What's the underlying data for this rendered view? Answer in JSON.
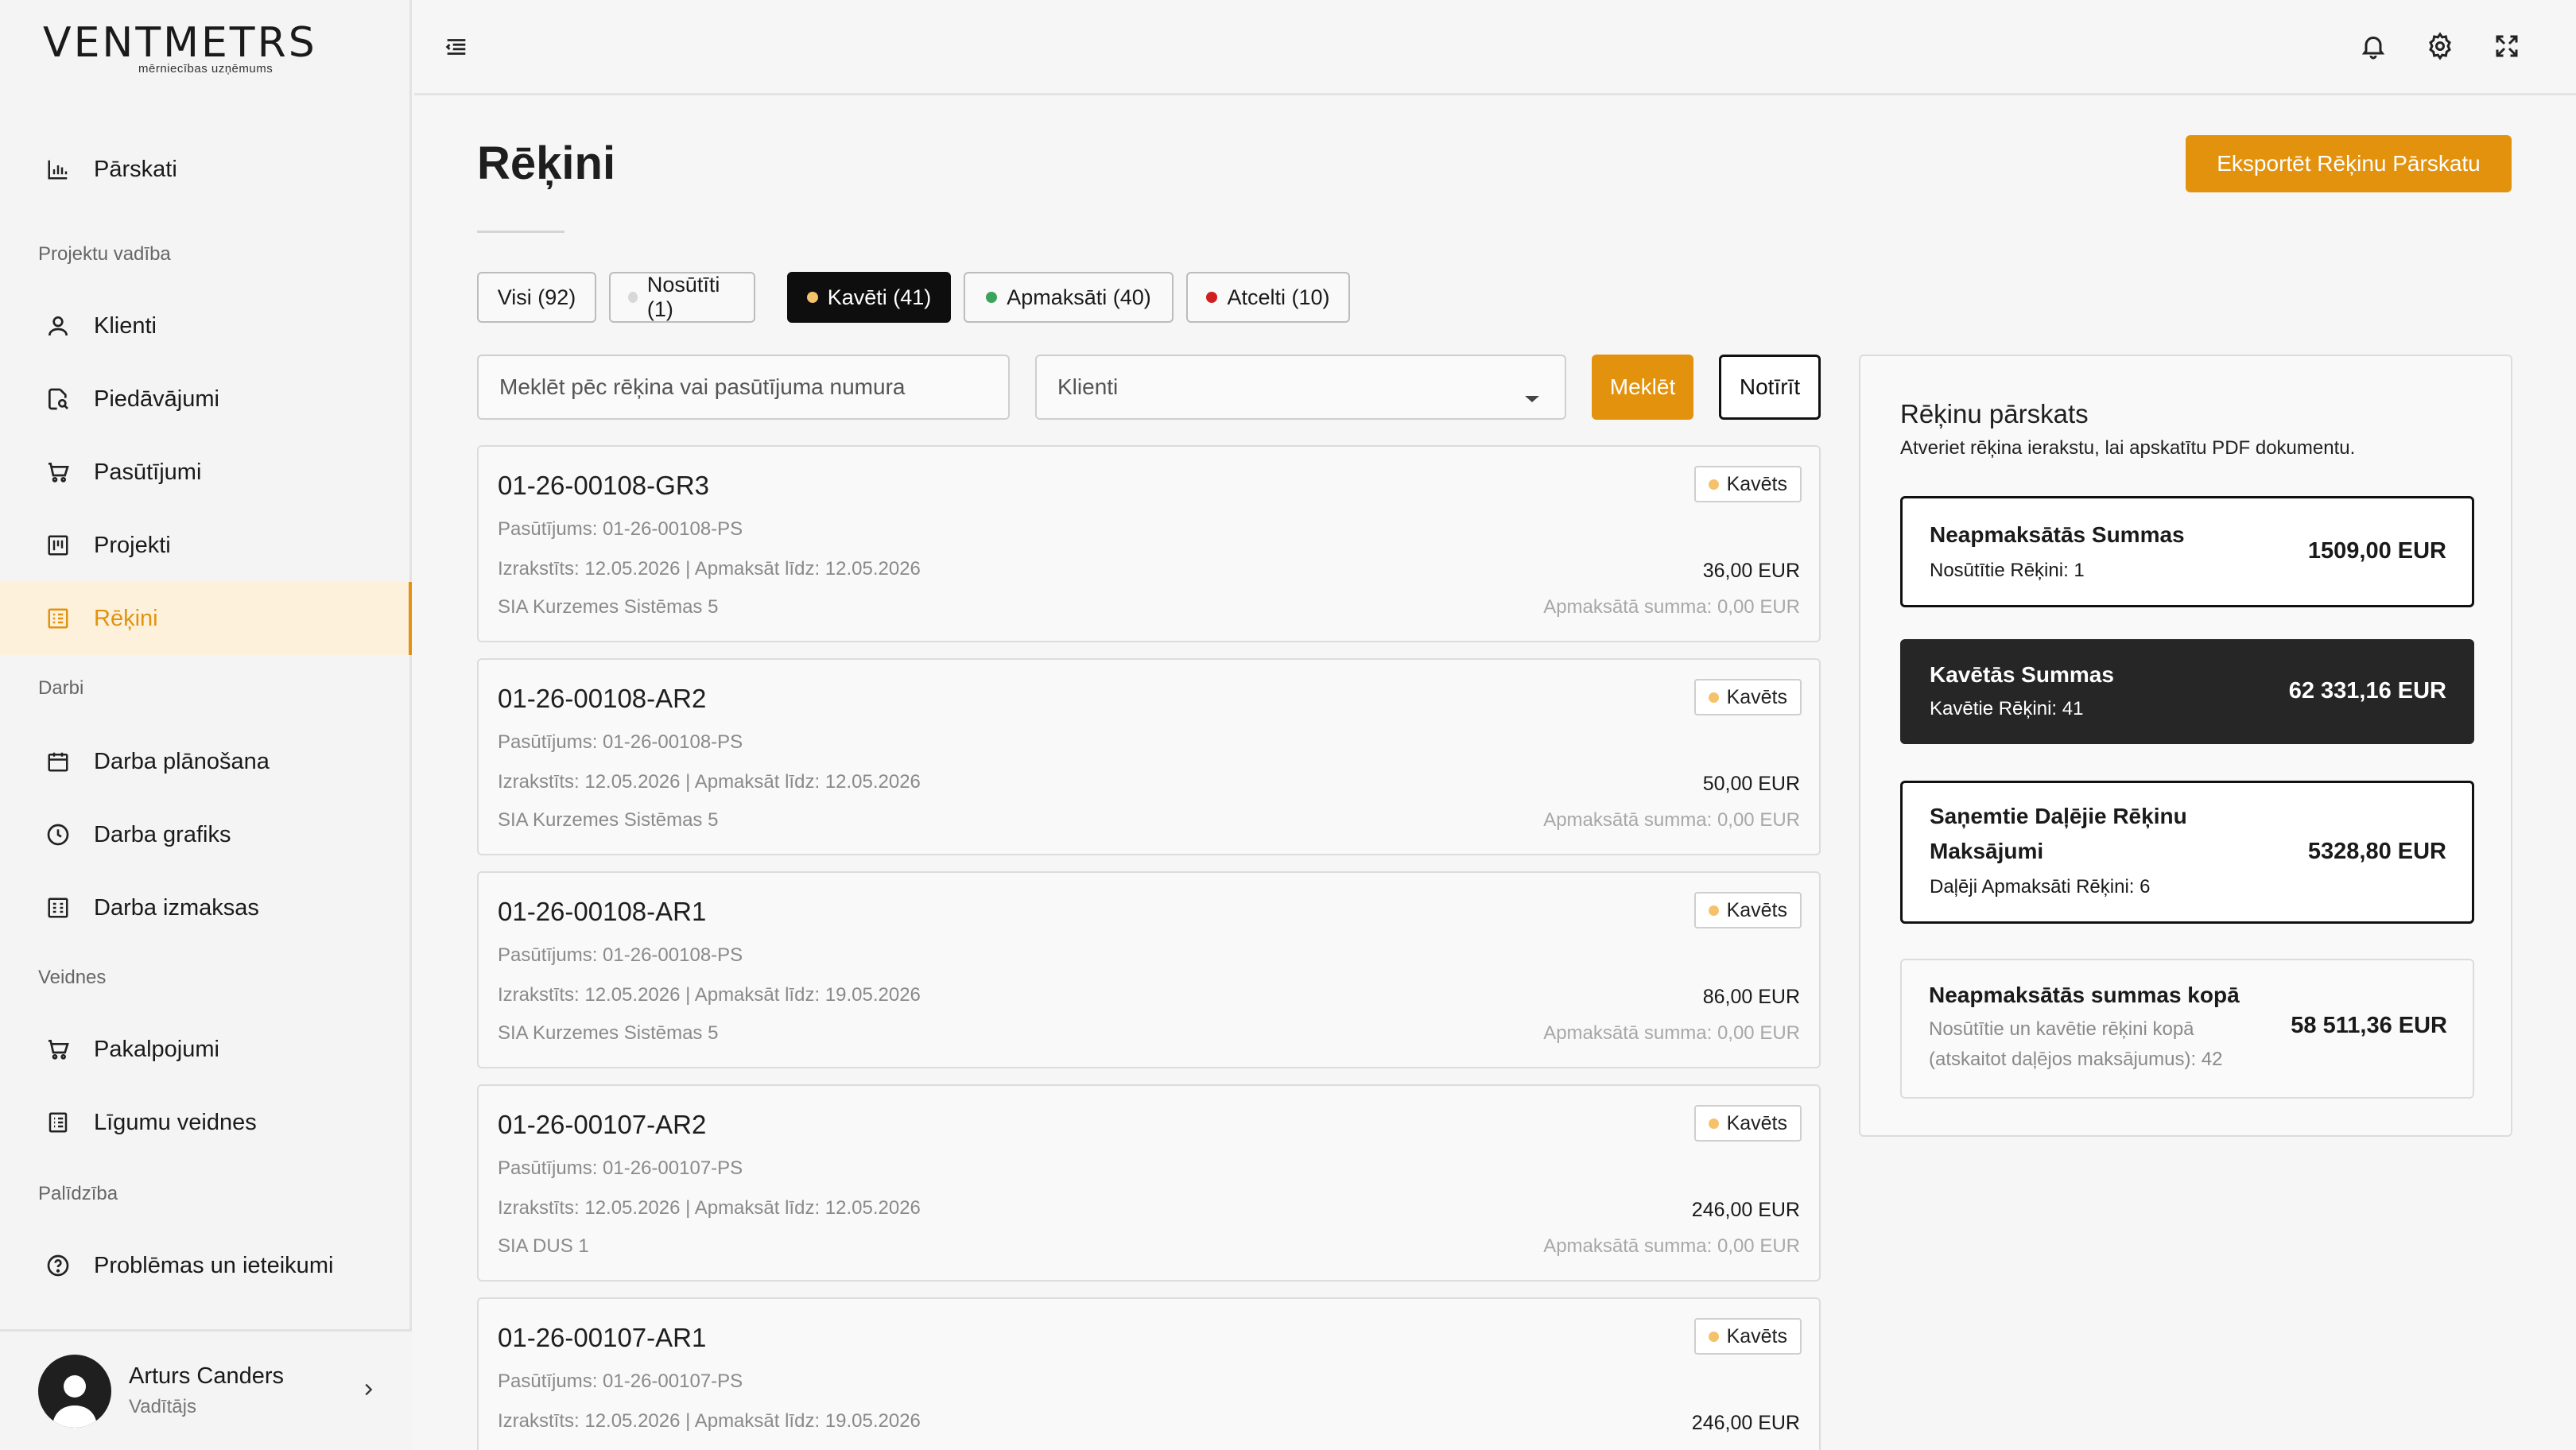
{
  "brand": {
    "name": "VENTMETRS",
    "tagline": "mērniecības uzņēmums"
  },
  "sidebar": {
    "items": [
      {
        "label": "Pārskati",
        "icon": "bar-chart-icon"
      },
      {
        "section": "Projektu vadība"
      },
      {
        "label": "Klienti",
        "icon": "user-icon"
      },
      {
        "label": "Piedāvājumi",
        "icon": "document-search-icon"
      },
      {
        "label": "Pasūtījumi",
        "icon": "cart-icon"
      },
      {
        "label": "Projekti",
        "icon": "kanban-icon"
      },
      {
        "label": "Rēķini",
        "icon": "invoice-icon",
        "active": true
      },
      {
        "section": "Darbi"
      },
      {
        "label": "Darba plānošana",
        "icon": "calendar-icon"
      },
      {
        "label": "Darba grafiks",
        "icon": "clock-icon"
      },
      {
        "label": "Darba izmaksas",
        "icon": "calculator-icon"
      },
      {
        "section": "Veidnes"
      },
      {
        "label": "Pakalpojumi",
        "icon": "cart-icon"
      },
      {
        "label": "Līgumu veidnes",
        "icon": "list-document-icon"
      },
      {
        "section": "Palīdzība"
      },
      {
        "label": "Problēmas un ieteikumi",
        "icon": "help-circle-icon"
      }
    ],
    "labels": {
      "reports": "Pārskati",
      "section_projects": "Projektu vadība",
      "clients": "Klienti",
      "offers": "Piedāvājumi",
      "orders": "Pasūtījumi",
      "projects": "Projekti",
      "invoices": "Rēķini",
      "section_work": "Darbi",
      "work_planning": "Darba plānošana",
      "work_schedule": "Darba grafiks",
      "work_costs": "Darba izmaksas",
      "section_templates": "Veidnes",
      "services": "Pakalpojumi",
      "contract_templates": "Līgumu veidnes",
      "section_help": "Palīdzība",
      "issues": "Problēmas un ieteikumi"
    }
  },
  "user": {
    "name": "Arturs Canders",
    "role": "Vadītājs"
  },
  "page": {
    "title": "Rēķini",
    "export_label": "Eksportēt Rēķinu Pārskatu"
  },
  "tabs": [
    {
      "label": "Visi (92)",
      "dot": null,
      "active": false
    },
    {
      "label": "Nosūtīti (1)",
      "dot": "#d8d8d8",
      "active": false
    },
    {
      "label": "Kavēti (41)",
      "dot": "#f5c26b",
      "active": true
    },
    {
      "label": "Apmaksāti (40)",
      "dot": "#3aa55a",
      "active": false
    },
    {
      "label": "Atcelti (10)",
      "dot": "#d11f1f",
      "active": false
    }
  ],
  "filters": {
    "search_placeholder": "Meklēt pēc rēķina vai pasūtījuma numura",
    "client_placeholder": "Klienti",
    "search_label": "Meklēt",
    "clear_label": "Notīrīt"
  },
  "invoices": [
    {
      "number": "01-26-00108-GR3",
      "order": "Pasūtījums: 01-26-00108-PS",
      "dates": "Izrakstīts: 12.05.2026 | Apmaksāt līdz: 12.05.2026",
      "client": "SIA Kurzemes Sistēmas 5",
      "status": "Kavēts",
      "amount": "36,00 EUR",
      "paid": "Apmaksātā summa: 0,00 EUR"
    },
    {
      "number": "01-26-00108-AR2",
      "order": "Pasūtījums: 01-26-00108-PS",
      "dates": "Izrakstīts: 12.05.2026 | Apmaksāt līdz: 12.05.2026",
      "client": "SIA Kurzemes Sistēmas 5",
      "status": "Kavēts",
      "amount": "50,00 EUR",
      "paid": "Apmaksātā summa: 0,00 EUR"
    },
    {
      "number": "01-26-00108-AR1",
      "order": "Pasūtījums: 01-26-00108-PS",
      "dates": "Izrakstīts: 12.05.2026 | Apmaksāt līdz: 19.05.2026",
      "client": "SIA Kurzemes Sistēmas 5",
      "status": "Kavēts",
      "amount": "86,00 EUR",
      "paid": "Apmaksātā summa: 0,00 EUR"
    },
    {
      "number": "01-26-00107-AR2",
      "order": "Pasūtījums: 01-26-00107-PS",
      "dates": "Izrakstīts: 12.05.2026 | Apmaksāt līdz: 12.05.2026",
      "client": "SIA DUS 1",
      "status": "Kavēts",
      "amount": "246,00 EUR",
      "paid": "Apmaksātā summa: 0,00 EUR"
    },
    {
      "number": "01-26-00107-AR1",
      "order": "Pasūtījums: 01-26-00107-PS",
      "dates": "Izrakstīts: 12.05.2026 | Apmaksāt līdz: 19.05.2026",
      "client": "",
      "status": "Kavēts",
      "amount": "246,00 EUR",
      "paid": ""
    }
  ],
  "summary": {
    "title": "Rēķinu pārskats",
    "subtitle": "Atveriet rēķina ierakstu, lai apskatītu PDF dokumentu.",
    "unpaid": {
      "label": "Neapmaksātās Summas",
      "note": "Nosūtītie Rēķini: 1",
      "value": "1509,00 EUR"
    },
    "overdue": {
      "label": "Kavētās Summas",
      "note": "Kavētie Rēķini: 41",
      "value": "62 331,16 EUR"
    },
    "partial": {
      "label": "Saņemtie Daļējie Rēķinu Maksājumi",
      "note": "Daļēji Apmaksāti Rēķini: 6",
      "value": "5328,80 EUR"
    },
    "total": {
      "label": "Neapmaksātās summas kopā",
      "note": "Nosūtītie un kavētie rēķini kopā (atskaitot daļējos maksājumus): 42",
      "value": "58 511,36 EUR"
    }
  },
  "colors": {
    "accent": "#e3920d",
    "overdue_dot": "#f5c26b",
    "dark_card": "#262626"
  }
}
